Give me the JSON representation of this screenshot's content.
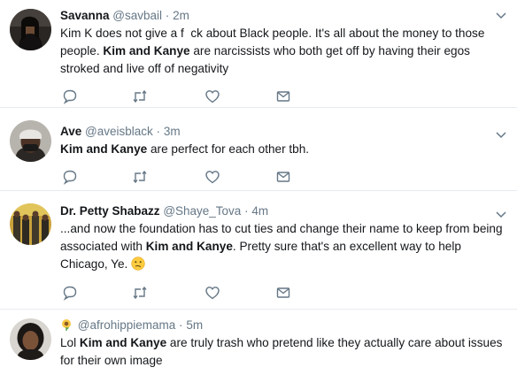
{
  "tweets": [
    {
      "name": "Savanna",
      "handle": "@savbail",
      "sep": "·",
      "time": "2m",
      "text_1": "Kim K does not give a f  ck about Black people. It's all about the money to those people. ",
      "bold_1": "Kim and Kanye",
      "text_2": " are narcissists who both get off by having their egos stroked and live off of negativity"
    },
    {
      "name": "Ave",
      "handle": "@aveisblack",
      "sep": "·",
      "time": "3m",
      "bold_1": "Kim and Kanye",
      "text_2": " are perfect for each other tbh."
    },
    {
      "name": "Dr. Petty Shabazz",
      "handle": "@Shaye_Tova",
      "sep": "·",
      "time": "4m",
      "text_1": "...and now the foundation has to cut ties and change their name to keep from being associated with ",
      "bold_1": "Kim and Kanye",
      "text_2": ". Pretty sure that's an excellent way to help Chicago, Ye. ",
      "emoji_icon": "confused-face-emoji-icon"
    },
    {
      "name_icon": "sunflower-emoji-icon",
      "handle": "@afrohippiemama",
      "sep": "·",
      "time": "5m",
      "text_1": "Lol ",
      "bold_1": "Kim and Kanye",
      "text_2": " are truly trash who pretend like they actually care about issues for their own image"
    }
  ],
  "icons": {
    "reply": "reply-icon",
    "retweet": "retweet-icon",
    "like": "like-icon",
    "dm": "direct-message-icon",
    "more": "chevron-down-icon"
  },
  "colors": {
    "text": "#14171a",
    "secondary": "#657786",
    "divider": "#e6ecf0"
  }
}
